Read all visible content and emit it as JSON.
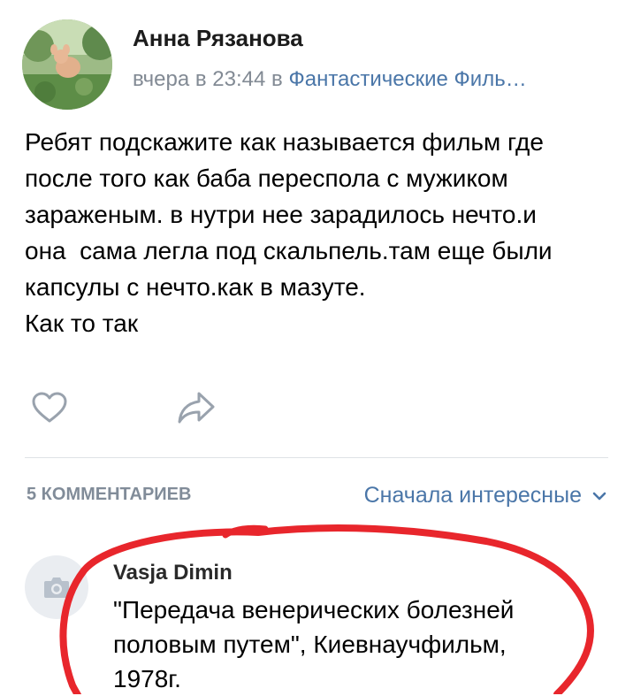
{
  "post": {
    "author": "Анна Рязанова",
    "time": "вчера в 23:44",
    "connector": " в ",
    "group": "Фантастические Филь…",
    "text_lines": [
      "Ребят подскажите как называется фильм где",
      "после того как баба переспола с мужиком",
      "зараженым. в нутри нее зарадилось нечто.и",
      "она  сама легла под скальпель.там еще были",
      "капсулы с нечто.как в мазуте.",
      "Как то так"
    ]
  },
  "comments_section": {
    "count_label": "5 КОММЕНТАРИЕВ",
    "sort_label": "Сначала интересные"
  },
  "comment": {
    "author": "Vasja Dimin",
    "text_lines": [
      "\"Передача венерических болезней",
      "половым путем\", Киевнаучфильм,",
      "1978г."
    ]
  },
  "colors": {
    "link": "#4a76a8",
    "secondary_text": "#828a94",
    "annotation": "#e8262c"
  },
  "icons": {
    "like": "heart-icon",
    "share": "share-arrow-icon",
    "sort": "chevron-down-icon",
    "comment_avatar": "camera-icon"
  }
}
